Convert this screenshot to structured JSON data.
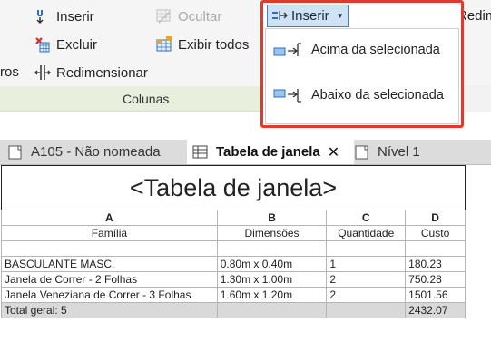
{
  "ribbon": {
    "left_fragment": "ros",
    "buttons": {
      "inserir": "Inserir",
      "ocultar": "Ocultar",
      "excluir": "Excluir",
      "exibir_todos": "Exibir  todos",
      "redimensionar": "Redimensionar"
    },
    "panel_title": "Colunas",
    "right_fragment": "Redim"
  },
  "dropdown": {
    "button_label": "Inserir",
    "items": [
      {
        "label": "Acima da selecionada"
      },
      {
        "label": "Abaixo da selecionada"
      }
    ]
  },
  "tabs": [
    {
      "label": "A105 - Não nomeada"
    },
    {
      "label": "Tabela de janela",
      "close": "✕"
    },
    {
      "label": "Nível 1"
    }
  ],
  "schedule": {
    "title": "<Tabela de janela>",
    "column_letters": [
      "A",
      "B",
      "C",
      "D"
    ],
    "column_names": [
      "Família",
      "Dimensões",
      "Quantidade",
      "Custo"
    ],
    "rows": [
      [
        "BASCULANTE MASC.",
        "0.80m x 0.40m",
        "1",
        "180.23"
      ],
      [
        "Janela de Correr - 2 Folhas",
        "1.30m x 1.00m",
        "2",
        "750.28"
      ],
      [
        "Janela Veneziana de Correr - 3 Folhas",
        "1.60m x 1.20m",
        "2",
        "1501.56"
      ]
    ],
    "total_label": "Total geral: 5",
    "total_value": "2432.07"
  },
  "colors": {
    "highlight": "#e03a2e",
    "selected_button": "#cfe3f6",
    "panel_title_bg": "#e8efdc"
  }
}
